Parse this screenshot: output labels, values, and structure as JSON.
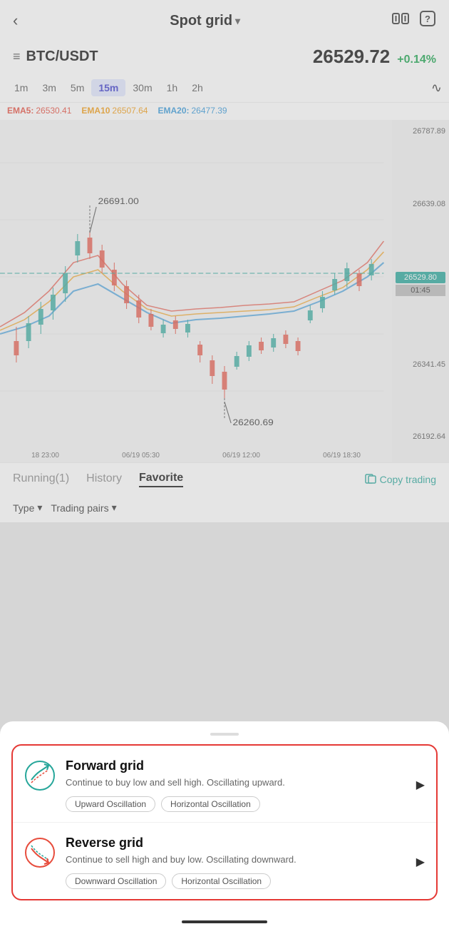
{
  "header": {
    "back_label": "‹",
    "title": "Spot grid",
    "title_arrow": "▾",
    "icon_compare": "⇔",
    "icon_help": "?"
  },
  "price_bar": {
    "menu_icon": "≡",
    "pair": "BTC/USDT",
    "current_price": "26529.72",
    "price_change": "+0.14%"
  },
  "time_bar": {
    "intervals": [
      "1m",
      "3m",
      "5m",
      "15m",
      "30m",
      "1h",
      "2h"
    ],
    "active": "15m",
    "chart_icon": "∿"
  },
  "ema": {
    "ema5_label": "EMA5:",
    "ema5_val": "26530.41",
    "ema10_label": "EMA10",
    "ema10_val": "26507.64",
    "ema20_label": "EMA20:",
    "ema20_val": "26477.39"
  },
  "chart": {
    "high_label": "26691.00",
    "low_label": "26260.69",
    "price_levels": [
      "26787.89",
      "26639.08",
      "26529.80",
      "26341.45",
      "26192.64"
    ],
    "current_price_tag": "26529.80",
    "time_tag": "01:45",
    "time_axis": [
      "18 23:00",
      "06/19 05:30",
      "06/19 12:00",
      "06/19 18:30"
    ]
  },
  "tabs": {
    "items": [
      {
        "label": "Running(1)",
        "active": false
      },
      {
        "label": "History",
        "active": false
      },
      {
        "label": "Favorite",
        "active": true
      }
    ],
    "copy_trading_icon": "⎘",
    "copy_trading_label": "Copy trading"
  },
  "filters": {
    "type_label": "Type",
    "type_arrow": "▾",
    "pairs_label": "Trading pairs",
    "pairs_arrow": "▾"
  },
  "bottom_sheet": {
    "options": [
      {
        "id": "forward_grid",
        "title": "Forward grid",
        "description": "Continue to buy low and sell high. Oscillating upward.",
        "tags": [
          "Upward Oscillation",
          "Horizontal Oscillation"
        ]
      },
      {
        "id": "reverse_grid",
        "title": "Reverse grid",
        "description": "Continue to sell high and buy low. Oscillating downward.",
        "tags": [
          "Downward Oscillation",
          "Horizontal Oscillation"
        ]
      }
    ]
  }
}
